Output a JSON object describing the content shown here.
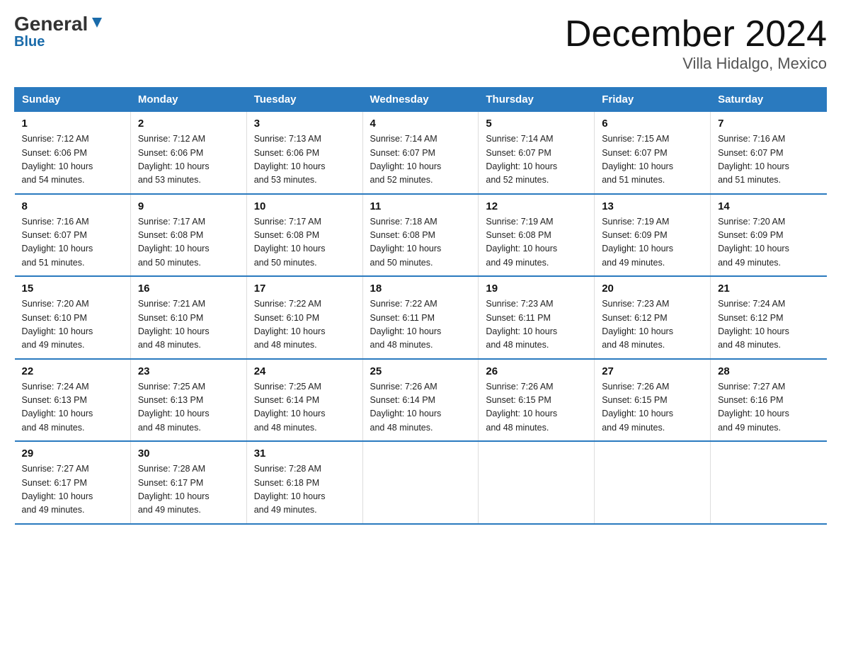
{
  "header": {
    "logo_general": "General",
    "logo_blue": "Blue",
    "title": "December 2024",
    "subtitle": "Villa Hidalgo, Mexico"
  },
  "days_of_week": [
    "Sunday",
    "Monday",
    "Tuesday",
    "Wednesday",
    "Thursday",
    "Friday",
    "Saturday"
  ],
  "weeks": [
    [
      {
        "day": "1",
        "sunrise": "7:12 AM",
        "sunset": "6:06 PM",
        "daylight": "10 hours and 54 minutes."
      },
      {
        "day": "2",
        "sunrise": "7:12 AM",
        "sunset": "6:06 PM",
        "daylight": "10 hours and 53 minutes."
      },
      {
        "day": "3",
        "sunrise": "7:13 AM",
        "sunset": "6:06 PM",
        "daylight": "10 hours and 53 minutes."
      },
      {
        "day": "4",
        "sunrise": "7:14 AM",
        "sunset": "6:07 PM",
        "daylight": "10 hours and 52 minutes."
      },
      {
        "day": "5",
        "sunrise": "7:14 AM",
        "sunset": "6:07 PM",
        "daylight": "10 hours and 52 minutes."
      },
      {
        "day": "6",
        "sunrise": "7:15 AM",
        "sunset": "6:07 PM",
        "daylight": "10 hours and 51 minutes."
      },
      {
        "day": "7",
        "sunrise": "7:16 AM",
        "sunset": "6:07 PM",
        "daylight": "10 hours and 51 minutes."
      }
    ],
    [
      {
        "day": "8",
        "sunrise": "7:16 AM",
        "sunset": "6:07 PM",
        "daylight": "10 hours and 51 minutes."
      },
      {
        "day": "9",
        "sunrise": "7:17 AM",
        "sunset": "6:08 PM",
        "daylight": "10 hours and 50 minutes."
      },
      {
        "day": "10",
        "sunrise": "7:17 AM",
        "sunset": "6:08 PM",
        "daylight": "10 hours and 50 minutes."
      },
      {
        "day": "11",
        "sunrise": "7:18 AM",
        "sunset": "6:08 PM",
        "daylight": "10 hours and 50 minutes."
      },
      {
        "day": "12",
        "sunrise": "7:19 AM",
        "sunset": "6:08 PM",
        "daylight": "10 hours and 49 minutes."
      },
      {
        "day": "13",
        "sunrise": "7:19 AM",
        "sunset": "6:09 PM",
        "daylight": "10 hours and 49 minutes."
      },
      {
        "day": "14",
        "sunrise": "7:20 AM",
        "sunset": "6:09 PM",
        "daylight": "10 hours and 49 minutes."
      }
    ],
    [
      {
        "day": "15",
        "sunrise": "7:20 AM",
        "sunset": "6:10 PM",
        "daylight": "10 hours and 49 minutes."
      },
      {
        "day": "16",
        "sunrise": "7:21 AM",
        "sunset": "6:10 PM",
        "daylight": "10 hours and 48 minutes."
      },
      {
        "day": "17",
        "sunrise": "7:22 AM",
        "sunset": "6:10 PM",
        "daylight": "10 hours and 48 minutes."
      },
      {
        "day": "18",
        "sunrise": "7:22 AM",
        "sunset": "6:11 PM",
        "daylight": "10 hours and 48 minutes."
      },
      {
        "day": "19",
        "sunrise": "7:23 AM",
        "sunset": "6:11 PM",
        "daylight": "10 hours and 48 minutes."
      },
      {
        "day": "20",
        "sunrise": "7:23 AM",
        "sunset": "6:12 PM",
        "daylight": "10 hours and 48 minutes."
      },
      {
        "day": "21",
        "sunrise": "7:24 AM",
        "sunset": "6:12 PM",
        "daylight": "10 hours and 48 minutes."
      }
    ],
    [
      {
        "day": "22",
        "sunrise": "7:24 AM",
        "sunset": "6:13 PM",
        "daylight": "10 hours and 48 minutes."
      },
      {
        "day": "23",
        "sunrise": "7:25 AM",
        "sunset": "6:13 PM",
        "daylight": "10 hours and 48 minutes."
      },
      {
        "day": "24",
        "sunrise": "7:25 AM",
        "sunset": "6:14 PM",
        "daylight": "10 hours and 48 minutes."
      },
      {
        "day": "25",
        "sunrise": "7:26 AM",
        "sunset": "6:14 PM",
        "daylight": "10 hours and 48 minutes."
      },
      {
        "day": "26",
        "sunrise": "7:26 AM",
        "sunset": "6:15 PM",
        "daylight": "10 hours and 48 minutes."
      },
      {
        "day": "27",
        "sunrise": "7:26 AM",
        "sunset": "6:15 PM",
        "daylight": "10 hours and 49 minutes."
      },
      {
        "day": "28",
        "sunrise": "7:27 AM",
        "sunset": "6:16 PM",
        "daylight": "10 hours and 49 minutes."
      }
    ],
    [
      {
        "day": "29",
        "sunrise": "7:27 AM",
        "sunset": "6:17 PM",
        "daylight": "10 hours and 49 minutes."
      },
      {
        "day": "30",
        "sunrise": "7:28 AM",
        "sunset": "6:17 PM",
        "daylight": "10 hours and 49 minutes."
      },
      {
        "day": "31",
        "sunrise": "7:28 AM",
        "sunset": "6:18 PM",
        "daylight": "10 hours and 49 minutes."
      },
      null,
      null,
      null,
      null
    ]
  ],
  "labels": {
    "sunrise": "Sunrise:",
    "sunset": "Sunset:",
    "daylight": "Daylight:"
  }
}
